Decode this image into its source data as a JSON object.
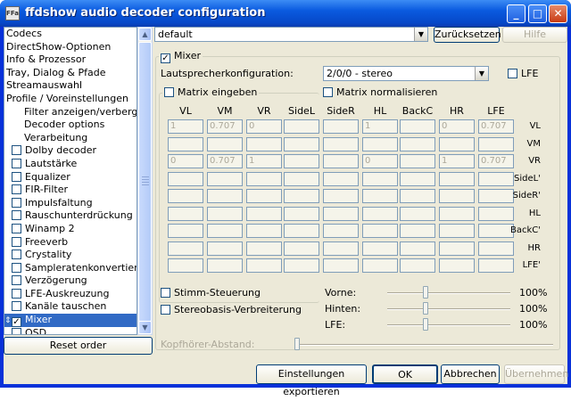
{
  "window": {
    "title": "ffdshow audio decoder configuration",
    "icon_text": "FFa"
  },
  "sidebar": {
    "items": [
      {
        "label": "Codecs",
        "check": "none",
        "indent": 0
      },
      {
        "label": "DirectShow-Optionen",
        "check": "none",
        "indent": 0
      },
      {
        "label": "Info & Prozessor",
        "check": "none",
        "indent": 0
      },
      {
        "label": "Tray, Dialog & Pfade",
        "check": "none",
        "indent": 0
      },
      {
        "label": "Streamauswahl",
        "check": "none",
        "indent": 0
      },
      {
        "label": "Profile / Voreinstellungen",
        "check": "none",
        "indent": 0
      },
      {
        "label": "Filter anzeigen/verbergen",
        "check": "none",
        "indent": 1
      },
      {
        "label": "Decoder options",
        "check": "none",
        "indent": 1
      },
      {
        "label": "Verarbeitung",
        "check": "none",
        "indent": 1
      },
      {
        "label": "Dolby decoder",
        "check": "unchecked",
        "indent": 0
      },
      {
        "label": "Lautstärke",
        "check": "unchecked",
        "indent": 0
      },
      {
        "label": "Equalizer",
        "check": "unchecked",
        "indent": 0
      },
      {
        "label": "FIR-Filter",
        "check": "unchecked",
        "indent": 0
      },
      {
        "label": "Impulsfaltung",
        "check": "unchecked",
        "indent": 0
      },
      {
        "label": "Rauschunterdrückung",
        "check": "unchecked",
        "indent": 0
      },
      {
        "label": "Winamp 2",
        "check": "unchecked",
        "indent": 0
      },
      {
        "label": "Freeverb",
        "check": "unchecked",
        "indent": 0
      },
      {
        "label": "Crystality",
        "check": "unchecked",
        "indent": 0
      },
      {
        "label": "Sampleratenkonvertierung",
        "check": "unchecked",
        "indent": 0
      },
      {
        "label": "Verzögerung",
        "check": "unchecked",
        "indent": 0
      },
      {
        "label": "LFE-Auskreuzung",
        "check": "unchecked",
        "indent": 0
      },
      {
        "label": "Kanäle tauschen",
        "check": "unchecked",
        "indent": 0
      },
      {
        "label": "Mixer",
        "check": "checked",
        "indent": 0,
        "selected": true
      },
      {
        "label": "OSD",
        "check": "unchecked",
        "indent": 0
      }
    ],
    "reset_label": "Reset order",
    "check_glyph": "✓",
    "drag_glyph": "⇕"
  },
  "preset": {
    "value": "default",
    "reset_label": "Zurücksetzen",
    "help_label": "Hilfe"
  },
  "mixer": {
    "enable_label": "Mixer",
    "speaker_label": "Lautsprecherkonfiguration:",
    "speaker_value": "2/0/0 - stereo",
    "lfe_label": "LFE",
    "matrix_input_label": "Matrix eingeben",
    "matrix_normalize_label": "Matrix normalisieren",
    "columns": [
      "VL",
      "VM",
      "VR",
      "SideL",
      "SideR",
      "HL",
      "BackC",
      "HR",
      "LFE"
    ],
    "rows": [
      {
        "label": "VL",
        "cells": [
          "1",
          "0.707",
          "0",
          "",
          "",
          "1",
          "",
          "0",
          "0.707"
        ]
      },
      {
        "label": "VM",
        "cells": [
          "",
          "",
          "",
          "",
          "",
          "",
          "",
          "",
          ""
        ]
      },
      {
        "label": "VR",
        "cells": [
          "0",
          "0.707",
          "1",
          "",
          "",
          "0",
          "",
          "1",
          "0.707"
        ]
      },
      {
        "label": "SideL'",
        "cells": [
          "",
          "",
          "",
          "",
          "",
          "",
          "",
          "",
          ""
        ]
      },
      {
        "label": "SideR'",
        "cells": [
          "",
          "",
          "",
          "",
          "",
          "",
          "",
          "",
          ""
        ]
      },
      {
        "label": "HL",
        "cells": [
          "",
          "",
          "",
          "",
          "",
          "",
          "",
          "",
          ""
        ]
      },
      {
        "label": "BackC'",
        "cells": [
          "",
          "",
          "",
          "",
          "",
          "",
          "",
          "",
          ""
        ]
      },
      {
        "label": "HR",
        "cells": [
          "",
          "",
          "",
          "",
          "",
          "",
          "",
          "",
          ""
        ]
      },
      {
        "label": "LFE'",
        "cells": [
          "",
          "",
          "",
          "",
          "",
          "",
          "",
          "",
          ""
        ]
      }
    ],
    "voice_control_label": "Stimm-Steuerung",
    "stereo_widen_label": "Stereobasis-Verbreiterung",
    "sliders": [
      {
        "label": "Vorne:",
        "value": "100%",
        "level": 0.3
      },
      {
        "label": "Hinten:",
        "value": "100%",
        "level": 0.3
      },
      {
        "label": "LFE:",
        "value": "100%",
        "level": 0.3
      }
    ],
    "headphone_label": "Kopfhörer-Abstand:",
    "headphone_level": 0.0
  },
  "footer": {
    "export_label": "Einstellungen exportieren",
    "ok_label": "OK",
    "cancel_label": "Abbrechen",
    "apply_label": "Übernehmen"
  }
}
